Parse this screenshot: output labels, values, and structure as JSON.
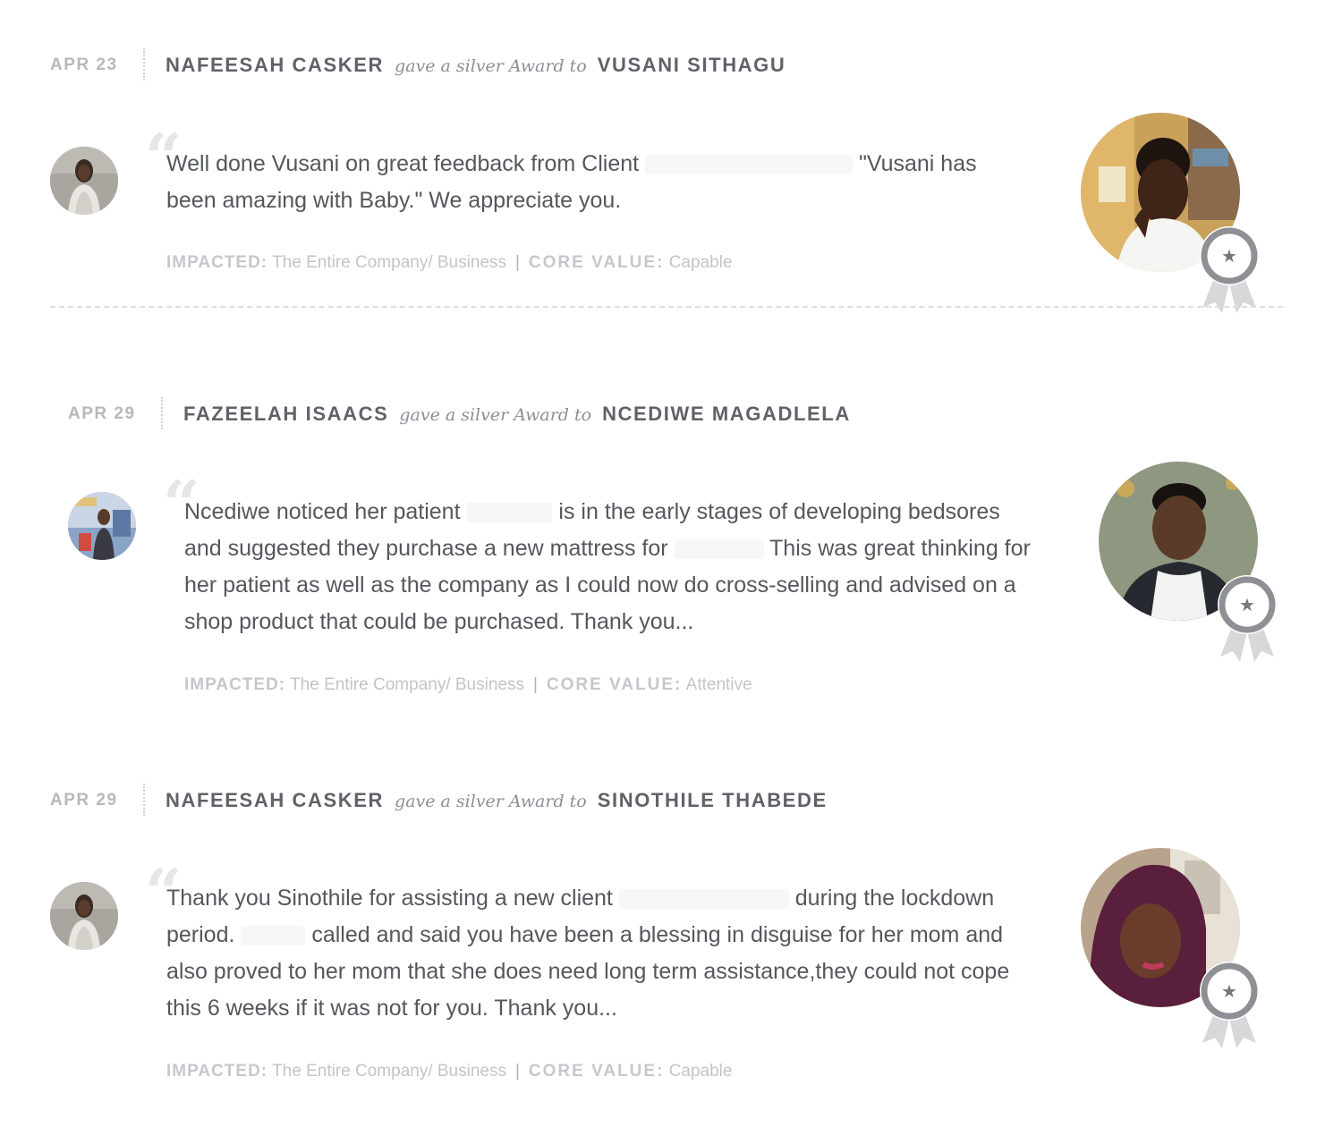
{
  "feed": [
    {
      "date": "APR 23",
      "giver": "NAFEESAH CASKER",
      "verb": "gave a silver Award to",
      "receiver": "VUSANI SITHAGU",
      "message_parts": [
        "Well done Vusani on great feedback from Client ",
        " \"Vusani has been amazing with Baby.\" We appreciate you."
      ],
      "impacted_label": "IMPACTED:",
      "impacted_value": "The Entire Company/ Business",
      "separator": "|",
      "core_value_label": "CORE VALUE:",
      "core_value_value": "Capable",
      "award_level": "silver"
    },
    {
      "date": "APR 29",
      "giver": "FAZEELAH ISAACS",
      "verb": "gave a silver Award to",
      "receiver": "NCEDIWE MAGADLELA",
      "message_parts": [
        "Ncediwe noticed her patient ",
        " is in the early stages of developing bedsores and suggested they purchase a new mattress for ",
        " This was great thinking for her patient as well as the company as I could now do cross-selling and advised on a shop product that could be purchased. Thank you..."
      ],
      "impacted_label": "IMPACTED:",
      "impacted_value": "The Entire Company/ Business",
      "separator": "|",
      "core_value_label": "CORE VALUE:",
      "core_value_value": "Attentive",
      "award_level": "silver"
    },
    {
      "date": "APR 29",
      "giver": "NAFEESAH CASKER",
      "verb": "gave a silver Award to",
      "receiver": "SINOTHILE THABEDE",
      "message_parts": [
        "Thank you Sinothile for assisting a new client ",
        " during the lockdown period. ",
        " called and said you have been a blessing in disguise for her mom and also proved to her mom that she does need long term assistance,they could not cope this 6 weeks if it was not for you. Thank you..."
      ],
      "impacted_label": "IMPACTED:",
      "impacted_value": "The Entire Company/ Business",
      "separator": "|",
      "core_value_label": "CORE VALUE:",
      "core_value_value": "Capable",
      "award_level": "silver"
    }
  ],
  "icons": {
    "quote": "quote-mark-icon",
    "award": "silver-award-medal-icon",
    "star": "star-icon"
  },
  "colors": {
    "medal_ring": "#8e9095",
    "medal_ribbon": "#d7d8da",
    "divider": "#dcdde0",
    "name_text": "#5f6268",
    "muted_text": "#c2c4c8"
  }
}
